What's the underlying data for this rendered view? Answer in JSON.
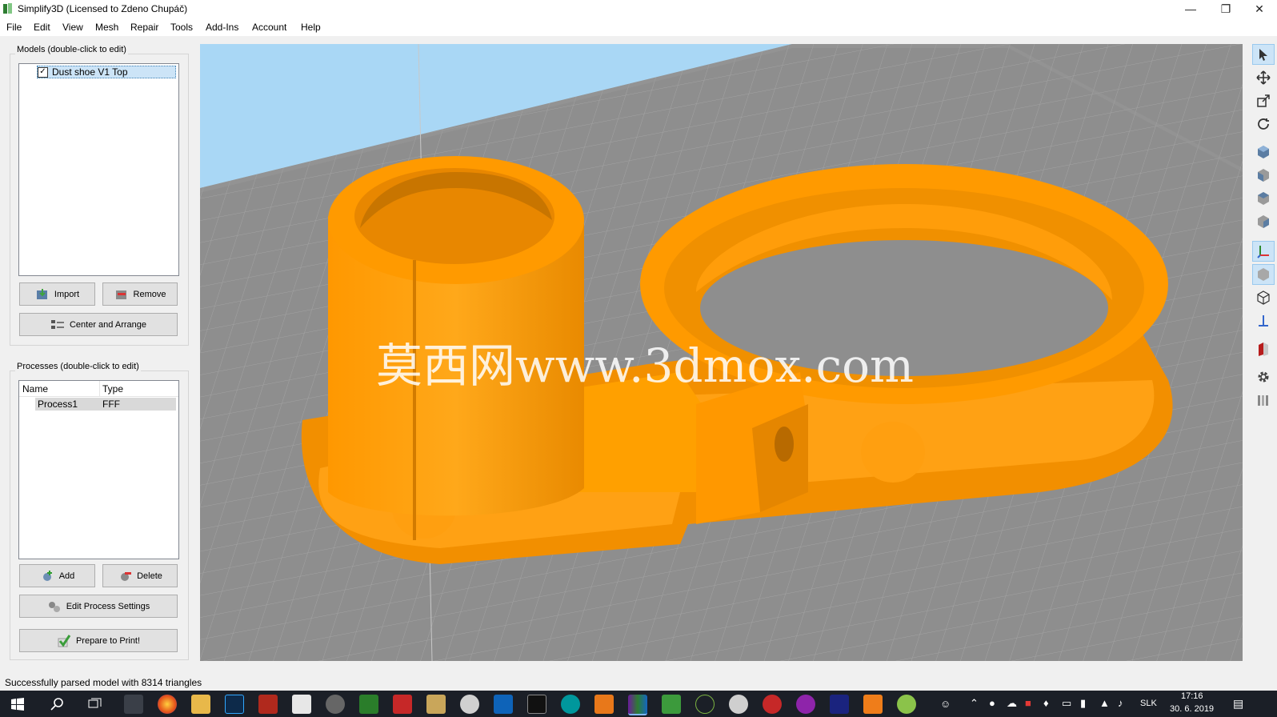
{
  "window": {
    "title": "Simplify3D (Licensed to Zdeno Chupáč)",
    "controls": [
      "minimize",
      "restore",
      "close"
    ]
  },
  "menu": [
    "File",
    "Edit",
    "View",
    "Mesh",
    "Repair",
    "Tools",
    "Add-Ins",
    "Account",
    "Help"
  ],
  "models_panel": {
    "title": "Models (double-click to edit)",
    "items": [
      {
        "label": "Dust shoe V1 Top",
        "checked": true
      }
    ],
    "import_label": "Import",
    "remove_label": "Remove",
    "center_label": "Center and Arrange"
  },
  "processes_panel": {
    "title": "Processes (double-click to edit)",
    "columns": [
      "Name",
      "Type"
    ],
    "rows": [
      {
        "name": "Process1",
        "type": "FFF"
      }
    ],
    "add_label": "Add",
    "delete_label": "Delete",
    "edit_label": "Edit Process Settings",
    "prepare_label": "Prepare to Print!"
  },
  "viewport": {
    "watermark": "莫西网www.3dmox.com",
    "model_color": "#ff9a00",
    "bed_color": "#8c8c8c",
    "sky_color": "#a9d7f5"
  },
  "toolbar_icons": [
    "select-icon",
    "move-icon",
    "scale-icon",
    "rotate-icon",
    "view-iso-icon",
    "view-front-icon",
    "view-top-icon",
    "view-side-icon",
    "axes-icon",
    "solid-view-icon",
    "wireframe-icon",
    "bottom-axis-icon",
    "section-icon",
    "settings-gear-icon",
    "bed-icon"
  ],
  "status": {
    "message": "Successfully parsed model with 8314 triangles"
  },
  "taskbar": {
    "language": "SLK",
    "time": "17:16",
    "date": "30. 6. 2019"
  },
  "colors": {
    "accent": "#0078d7",
    "selection": "#cce4f7"
  }
}
